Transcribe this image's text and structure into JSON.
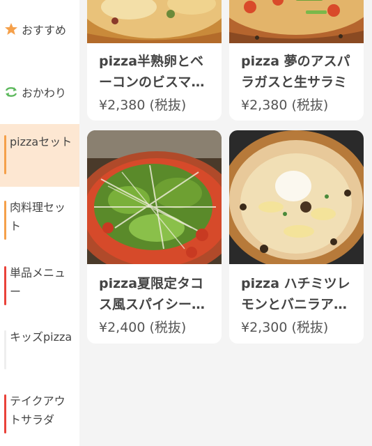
{
  "sidebar": {
    "items": [
      {
        "label": "おすすめ",
        "icon": "star-icon"
      },
      {
        "label": "おかわり",
        "icon": "refresh-icon"
      }
    ],
    "categories": [
      {
        "label": "pizzaセット",
        "accent": "#f5a04a",
        "active": true
      },
      {
        "label": "肉料理セット",
        "accent": "#f5a04a",
        "active": false
      },
      {
        "label": "単品メニュー",
        "accent": "#e9423a",
        "active": false
      },
      {
        "label": "キッズpizza",
        "accent": "#eeeeee",
        "active": false
      },
      {
        "label": "テイクアウトサラダ",
        "accent": "#e9423a",
        "active": false
      }
    ]
  },
  "products": [
    {
      "title": "pizza半熟卵とベーコンのビスマルク",
      "price": "¥2,380 (税抜)"
    },
    {
      "title": "pizza 夢のアスパラガスと生サラミ",
      "price": "¥2,380 (税抜)"
    },
    {
      "title": "pizza夏限定タコス風スパイシー…",
      "price": "¥2,400 (税抜)"
    },
    {
      "title": "pizza ハチミツレモンとバニラア…",
      "price": "¥2,300 (税抜)"
    }
  ],
  "colors": {
    "active_bg": "#fde7d2",
    "star": "#f5a04a",
    "refresh": "#5cb85c"
  }
}
